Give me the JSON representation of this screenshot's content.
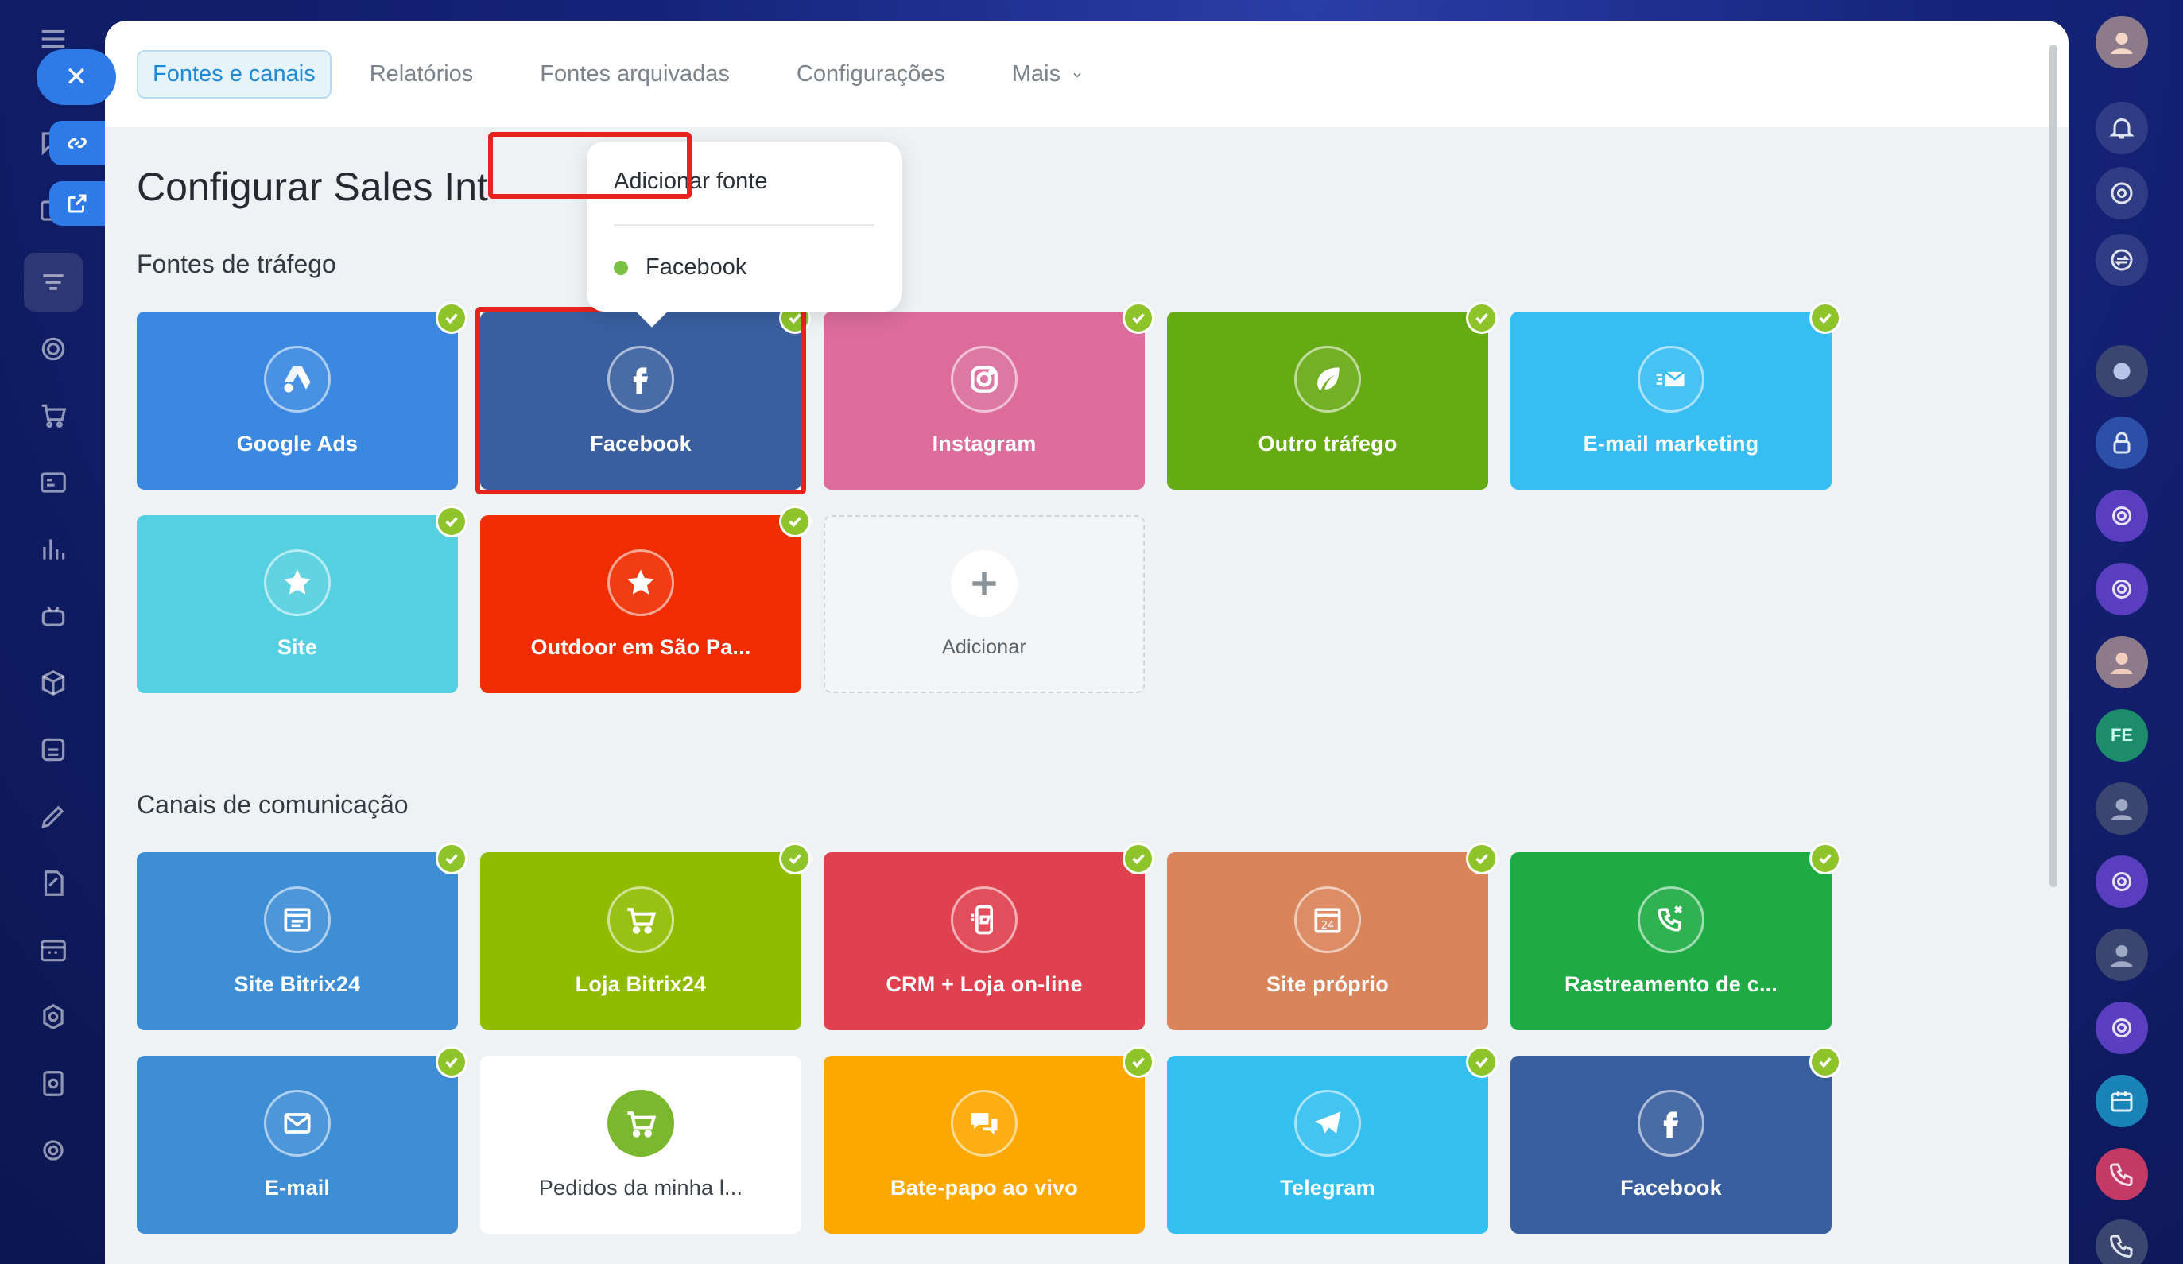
{
  "nav": {
    "tabs": [
      {
        "label": "Fontes e canais"
      },
      {
        "label": "Relatórios"
      },
      {
        "label": "Fontes arquivadas"
      },
      {
        "label": "Configurações"
      },
      {
        "label": "Mais"
      }
    ]
  },
  "page": {
    "title": "Configurar Sales Int"
  },
  "traffic": {
    "title": "Fontes de tráfego",
    "tiles": [
      {
        "label": "Google Ads",
        "color": "#3a88e0",
        "icon": "google-ads-icon"
      },
      {
        "label": "Facebook",
        "color": "#3a5f9f",
        "icon": "facebook-icon"
      },
      {
        "label": "Instagram",
        "color": "#db6c9c",
        "icon": "instagram-icon"
      },
      {
        "label": "Outro tráfego",
        "color": "#66ab13",
        "icon": "leaf-icon"
      },
      {
        "label": "E-mail marketing",
        "color": "#37bdf2",
        "icon": "email-marketing-icon"
      },
      {
        "label": "Site",
        "color": "#55d0e0",
        "icon": "star-icon"
      },
      {
        "label": "Outdoor em São Pa...",
        "color": "#f02d00",
        "icon": "star-icon"
      },
      {
        "label": "Adicionar",
        "icon": "plus-icon"
      }
    ]
  },
  "channels": {
    "title": "Canais de comunicação",
    "tiles": [
      {
        "label": "Site Bitrix24",
        "color": "#3e8ed6",
        "icon": "site-icon"
      },
      {
        "label": "Loja Bitrix24",
        "color": "#8fbc00",
        "icon": "cart-icon"
      },
      {
        "label": "CRM + Loja on-line",
        "color": "#e0414f",
        "icon": "crm-store-icon"
      },
      {
        "label": "Site próprio",
        "color": "#d9845a",
        "icon": "calendar-24-icon"
      },
      {
        "label": "Rastreamento de c...",
        "color": "#1fab44",
        "icon": "phone-tracking-icon"
      },
      {
        "label": "E-mail",
        "color": "#3e8ed6",
        "icon": "mail-icon"
      },
      {
        "label": "Pedidos da minha l...",
        "color": "#ffffff",
        "icon": "cart-icon"
      },
      {
        "label": "Bate-papo ao vivo",
        "color": "#fca800",
        "icon": "chat-icon"
      },
      {
        "label": "Telegram",
        "color": "#33bff0",
        "icon": "telegram-icon"
      },
      {
        "label": "Facebook",
        "color": "#3a5f9f",
        "icon": "facebook-icon"
      }
    ]
  },
  "popup": {
    "heading": "Adicionar fonte",
    "items": [
      {
        "label": "Facebook",
        "status_color": "#7cc242"
      }
    ]
  },
  "right_bar": {
    "badge_initials": "FE"
  },
  "colors": {
    "accent": "#1e8ad6",
    "highlight": "#e8231d",
    "check": "#8cc42a"
  }
}
